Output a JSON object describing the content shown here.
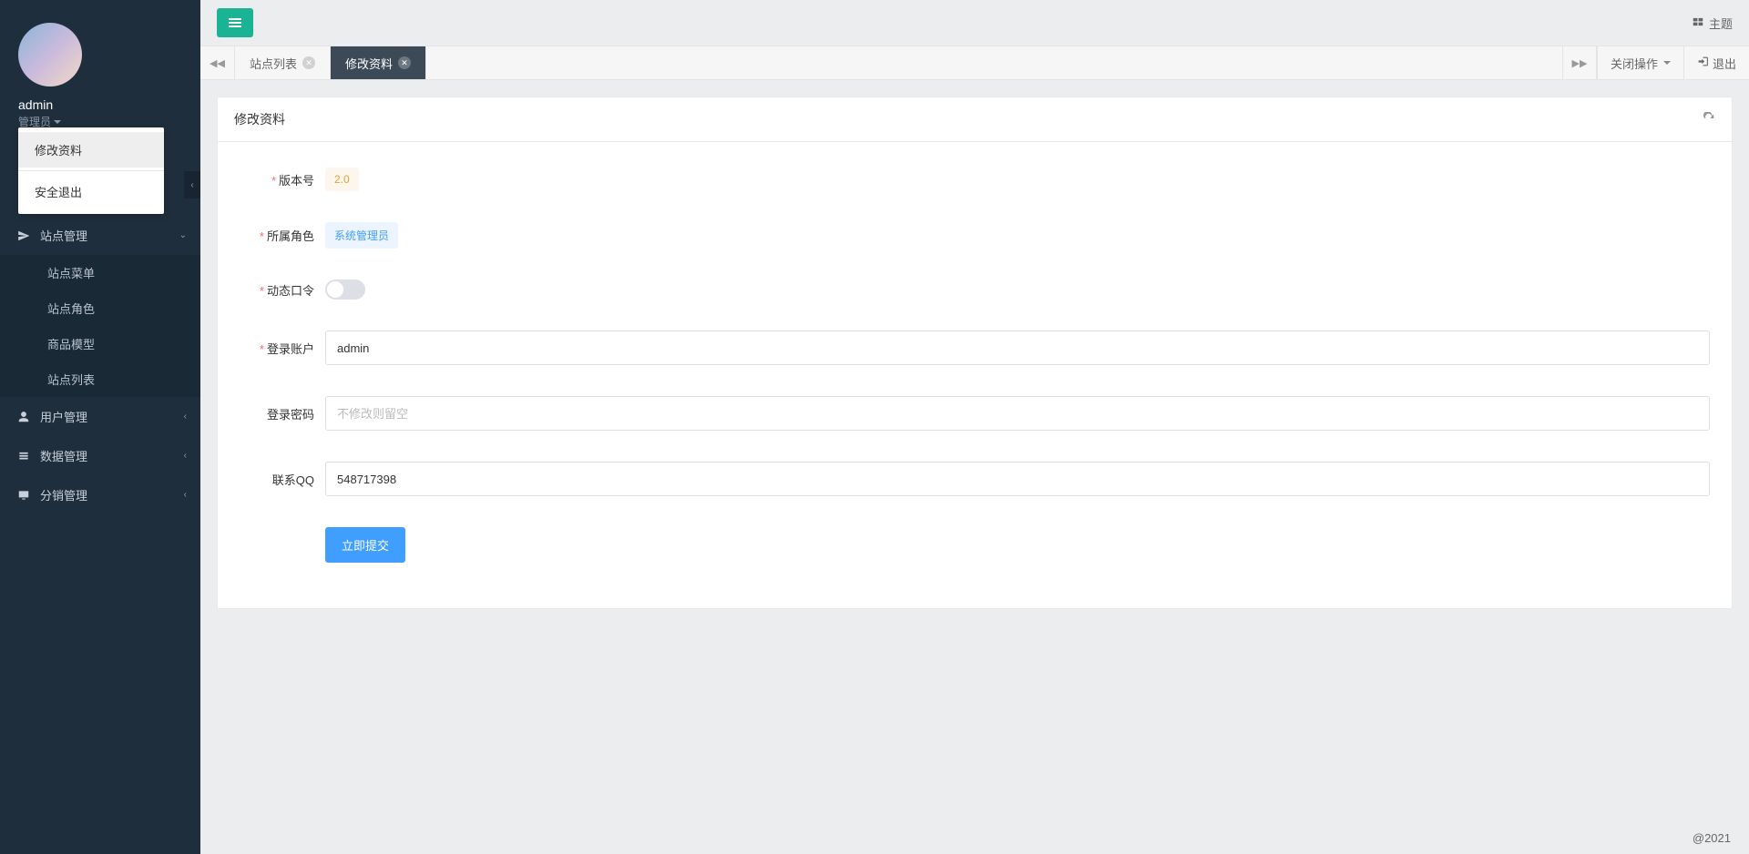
{
  "sidebar": {
    "profile": {
      "name": "admin",
      "role": "管理员"
    },
    "dropdown": {
      "edit_profile": "修改资料",
      "logout": "安全退出"
    },
    "menu": {
      "site": {
        "label": "站点管理",
        "items": [
          "站点菜单",
          "站点角色",
          "商品模型",
          "站点列表"
        ]
      },
      "user": {
        "label": "用户管理"
      },
      "data": {
        "label": "数据管理"
      },
      "distribution": {
        "label": "分销管理"
      }
    }
  },
  "topbar": {
    "theme": "主题"
  },
  "tabs": {
    "items": [
      {
        "label": "站点列表",
        "active": false
      },
      {
        "label": "修改资料",
        "active": true
      }
    ],
    "close_ops": "关闭操作",
    "logout": "退出"
  },
  "panel": {
    "title": "修改资料"
  },
  "form": {
    "version": {
      "label": "版本号",
      "value": "2.0"
    },
    "role": {
      "label": "所属角色",
      "value": "系统管理员"
    },
    "otp": {
      "label": "动态口令"
    },
    "account": {
      "label": "登录账户",
      "value": "admin"
    },
    "password": {
      "label": "登录密码",
      "placeholder": "不修改则留空"
    },
    "qq": {
      "label": "联系QQ",
      "value": "548717398"
    },
    "submit": "立即提交"
  },
  "footer": "@2021"
}
